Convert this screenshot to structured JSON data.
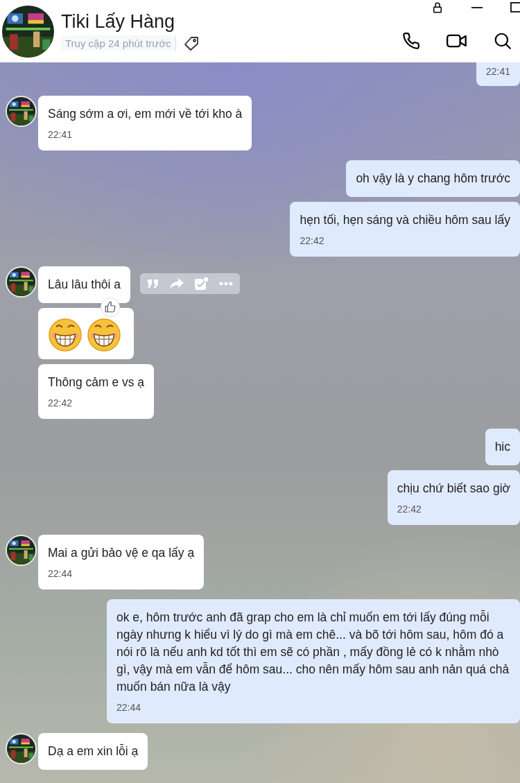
{
  "header": {
    "title": "Tiki Lấy Hàng",
    "status": "Truy cập 24 phút trước"
  },
  "messages": [
    {
      "outgoing": true,
      "kind": "text",
      "clipped": true,
      "time": "22:41"
    },
    {
      "outgoing": false,
      "kind": "text",
      "avatar": true,
      "text": "Sáng sớm a ơi, em mới về tới kho à",
      "time": "22:41"
    },
    {
      "outgoing": true,
      "kind": "text",
      "text": "oh vậy là y chang hôm trước"
    },
    {
      "outgoing": true,
      "kind": "text",
      "text": "hẹn tối, hẹn sáng và chiều hôm sau lấy",
      "time": "22:42"
    },
    {
      "outgoing": false,
      "kind": "text",
      "avatar": true,
      "hovered": true,
      "text": "Lâu lâu thôi a"
    },
    {
      "outgoing": false,
      "kind": "emoji",
      "reacted": true
    },
    {
      "outgoing": false,
      "kind": "text",
      "text": "Thông cảm e vs ạ",
      "time": "22:42"
    },
    {
      "outgoing": true,
      "kind": "text",
      "text": "hic"
    },
    {
      "outgoing": true,
      "kind": "text",
      "text": "chịu chứ biết sao giờ",
      "time": "22:42"
    },
    {
      "outgoing": false,
      "kind": "text",
      "avatar": true,
      "text": "Mai a gửi bảo vệ e qa lấy ạ",
      "time": "22:44"
    },
    {
      "outgoing": true,
      "kind": "text",
      "text": "ok e, hôm trước anh đã grap cho em là chỉ muốn em tới lấy đúng mỗi ngày nhưng k hiểu vì lý do gì mà em chê... và bõ tới hôm sau, hôm đó a nói rõ là nếu anh kd tốt thì em sẽ có phần , mấy đồng lẻ có k nhằm nhò gì, vậy mà em vẫn để hôm sau... cho nên mấy hôm sau anh nản quá chả muốn bán nữa là vậy",
      "time": "22:44"
    },
    {
      "outgoing": false,
      "kind": "text",
      "avatar": true,
      "text": "Dạ a em xin lỗi ạ"
    }
  ]
}
